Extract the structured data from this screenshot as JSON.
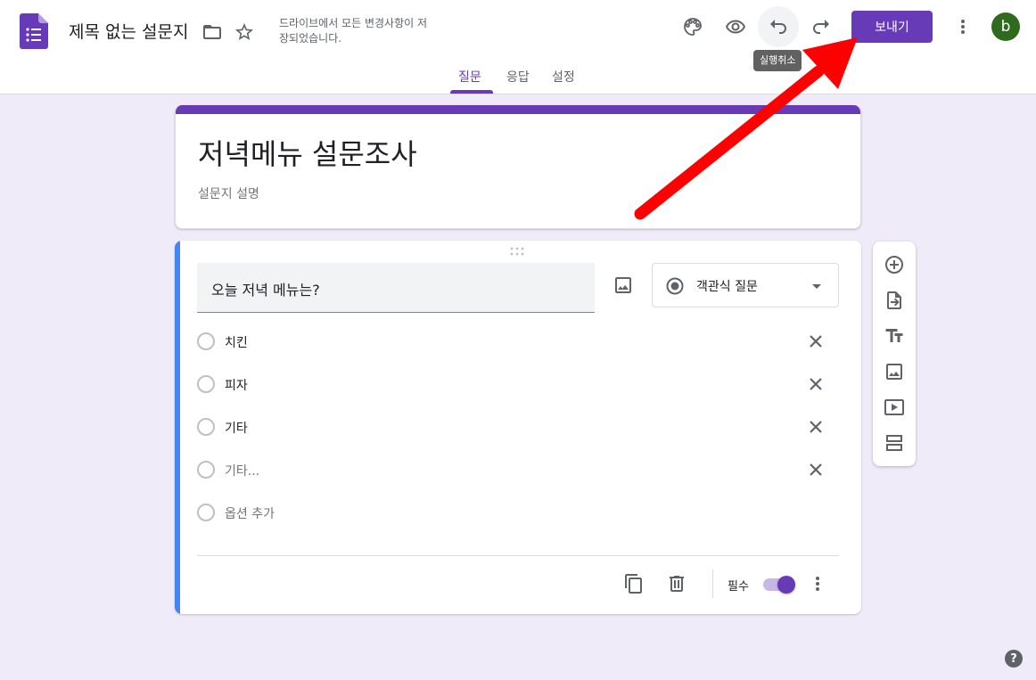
{
  "header": {
    "doc_title": "제목 없는 설문지",
    "save_status": "드라이브에서 모든 변경사항이 저장되었습니다.",
    "send_label": "보내기",
    "undo_tooltip": "실행취소",
    "avatar_letter": "b"
  },
  "tabs": [
    {
      "label": "질문",
      "active": true
    },
    {
      "label": "응답",
      "active": false
    },
    {
      "label": "설정",
      "active": false
    }
  ],
  "form": {
    "title": "저녁메뉴 설문조사",
    "description_placeholder": "설문지 설명"
  },
  "question": {
    "text": "오늘 저녁 메뉴는?",
    "type": "객관식 질문",
    "options": [
      {
        "label": "치킨"
      },
      {
        "label": "피자"
      },
      {
        "label": "기타"
      },
      {
        "label": "기타..."
      }
    ],
    "add_option_label": "옵션 추가",
    "required_label": "필수",
    "required": true
  },
  "help_label": "?",
  "colors": {
    "accent": "#673ab7",
    "background": "#f0ebf8",
    "active_question_bar": "#4285f4",
    "annotation_arrow": "#ff0000"
  }
}
